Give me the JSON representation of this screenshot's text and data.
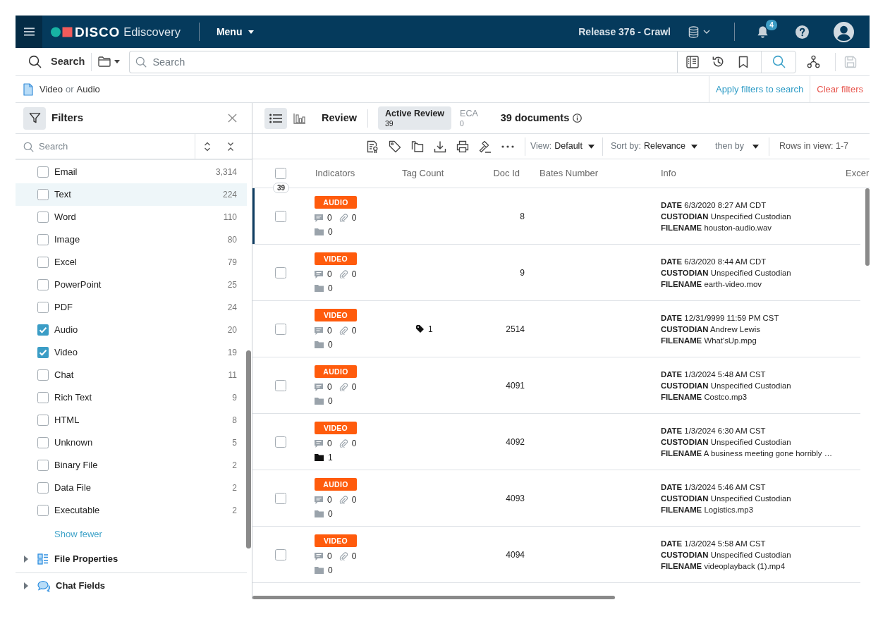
{
  "top_bar": {
    "brand": "DISCO",
    "product": "Ediscovery",
    "menu": "Menu",
    "release": "Release 376 - Crawl",
    "notifications": "4"
  },
  "search_bar": {
    "label": "Search",
    "placeholder": "Search",
    "save_disabled": true
  },
  "query": {
    "parts": [
      {
        "text": "Video",
        "kind": "term"
      },
      {
        "text": "or",
        "kind": "operator"
      },
      {
        "text": "Audio",
        "kind": "term"
      }
    ],
    "actions": [
      {
        "label": "Apply filters to search",
        "kind": "apply"
      },
      {
        "label": "Clear filters",
        "kind": "clear"
      }
    ]
  },
  "filters_panel": {
    "title": "Filters",
    "search_placeholder": "Search",
    "items": [
      {
        "label": "Email",
        "count": "3,314",
        "checked": false,
        "highlighted": false
      },
      {
        "label": "Text",
        "count": "224",
        "checked": false,
        "highlighted": true
      },
      {
        "label": "Word",
        "count": "110",
        "checked": false,
        "highlighted": false
      },
      {
        "label": "Image",
        "count": "80",
        "checked": false,
        "highlighted": false
      },
      {
        "label": "Excel",
        "count": "79",
        "checked": false,
        "highlighted": false
      },
      {
        "label": "PowerPoint",
        "count": "25",
        "checked": false,
        "highlighted": false
      },
      {
        "label": "PDF",
        "count": "24",
        "checked": false,
        "highlighted": false
      },
      {
        "label": "Audio",
        "count": "20",
        "checked": true,
        "highlighted": false
      },
      {
        "label": "Video",
        "count": "19",
        "checked": true,
        "highlighted": false
      },
      {
        "label": "Chat",
        "count": "11",
        "checked": false,
        "highlighted": false
      },
      {
        "label": "Rich Text",
        "count": "9",
        "checked": false,
        "highlighted": false
      },
      {
        "label": "HTML",
        "count": "8",
        "checked": false,
        "highlighted": false
      },
      {
        "label": "Unknown",
        "count": "5",
        "checked": false,
        "highlighted": false
      },
      {
        "label": "Binary File",
        "count": "2",
        "checked": false,
        "highlighted": false
      },
      {
        "label": "Data File",
        "count": "2",
        "checked": false,
        "highlighted": false
      },
      {
        "label": "Executable",
        "count": "2",
        "checked": false,
        "highlighted": false
      }
    ],
    "show_fewer": "Show fewer",
    "sections": [
      {
        "label": "File Properties",
        "kind": "properties",
        "expanded": false
      },
      {
        "label": "Chat Fields",
        "kind": "chat",
        "expanded": false
      }
    ]
  },
  "results": {
    "views": [
      {
        "kind": "list",
        "selected": true
      },
      {
        "kind": "chart",
        "selected": false
      }
    ],
    "title": "Review",
    "tabs": [
      {
        "label": "Active Review",
        "count": "39",
        "selected": true
      },
      {
        "label": "ECA",
        "count": "0",
        "selected": false
      }
    ],
    "document_count": "39 documents",
    "toolbar": {
      "dropdowns": [
        {
          "label": "View:",
          "value": "Default"
        },
        {
          "label": "Sort by:",
          "value": "Relevance"
        },
        {
          "label": "then by"
        }
      ],
      "rows_in_view": "Rows in view: 1-7"
    },
    "table": {
      "columns": [
        "Indicators",
        "Tag Count",
        "Doc Id",
        "Bates Number",
        "Info",
        "Excer"
      ],
      "all_checked": false,
      "selection_count": "39",
      "rows": [
        {
          "type": "AUDIO",
          "checked": false,
          "current": true,
          "comments": "0",
          "attachments": "0",
          "folders": "0",
          "filed": false,
          "doc_id": "8",
          "info": [
            {
              "label": "DATE",
              "value": "6/3/2020 8:27 AM CDT"
            },
            {
              "label": "CUSTODIAN",
              "value": "Unspecified Custodian"
            },
            {
              "label": "FILENAME",
              "value": "houston-audio.wav"
            }
          ]
        },
        {
          "type": "VIDEO",
          "checked": false,
          "current": false,
          "comments": "0",
          "attachments": "0",
          "folders": "0",
          "filed": false,
          "doc_id": "9",
          "info": [
            {
              "label": "DATE",
              "value": "6/3/2020 8:44 AM CDT"
            },
            {
              "label": "CUSTODIAN",
              "value": "Unspecified Custodian"
            },
            {
              "label": "FILENAME",
              "value": "earth-video.mov"
            }
          ]
        },
        {
          "type": "VIDEO",
          "checked": false,
          "current": false,
          "comments": "0",
          "attachments": "0",
          "folders": "0",
          "filed": false,
          "tag_count": "1",
          "doc_id": "2514",
          "info": [
            {
              "label": "DATE",
              "value": "12/31/9999 11:59 PM CST"
            },
            {
              "label": "CUSTODIAN",
              "value": "Andrew Lewis"
            },
            {
              "label": "FILENAME",
              "value": "What'sUp.mpg"
            }
          ]
        },
        {
          "type": "AUDIO",
          "checked": false,
          "current": false,
          "comments": "0",
          "attachments": "0",
          "folders": "0",
          "filed": false,
          "doc_id": "4091",
          "info": [
            {
              "label": "DATE",
              "value": "1/3/2024 5:48 AM CST"
            },
            {
              "label": "CUSTODIAN",
              "value": "Unspecified Custodian"
            },
            {
              "label": "FILENAME",
              "value": "Costco.mp3"
            }
          ]
        },
        {
          "type": "VIDEO",
          "checked": false,
          "current": false,
          "comments": "0",
          "attachments": "0",
          "folders": "1",
          "filed": true,
          "doc_id": "4092",
          "info": [
            {
              "label": "DATE",
              "value": "1/3/2024 6:30 AM CST"
            },
            {
              "label": "CUSTODIAN",
              "value": "Unspecified Custodian"
            },
            {
              "label": "FILENAME",
              "value": "A business meeting gone horribly …"
            }
          ]
        },
        {
          "type": "AUDIO",
          "checked": false,
          "current": false,
          "comments": "0",
          "attachments": "0",
          "folders": "0",
          "filed": false,
          "doc_id": "4093",
          "info": [
            {
              "label": "DATE",
              "value": "1/3/2024 5:46 AM CST"
            },
            {
              "label": "CUSTODIAN",
              "value": "Unspecified Custodian"
            },
            {
              "label": "FILENAME",
              "value": "Logistics.mp3"
            }
          ]
        },
        {
          "type": "VIDEO",
          "checked": false,
          "current": false,
          "comments": "0",
          "attachments": "0",
          "folders": "0",
          "filed": false,
          "doc_id": "4094",
          "info": [
            {
              "label": "DATE",
              "value": "1/3/2024 5:58 AM CST"
            },
            {
              "label": "CUSTODIAN",
              "value": "Unspecified Custodian"
            },
            {
              "label": "FILENAME",
              "value": "videoplayback (1).mp4"
            }
          ]
        }
      ]
    }
  }
}
